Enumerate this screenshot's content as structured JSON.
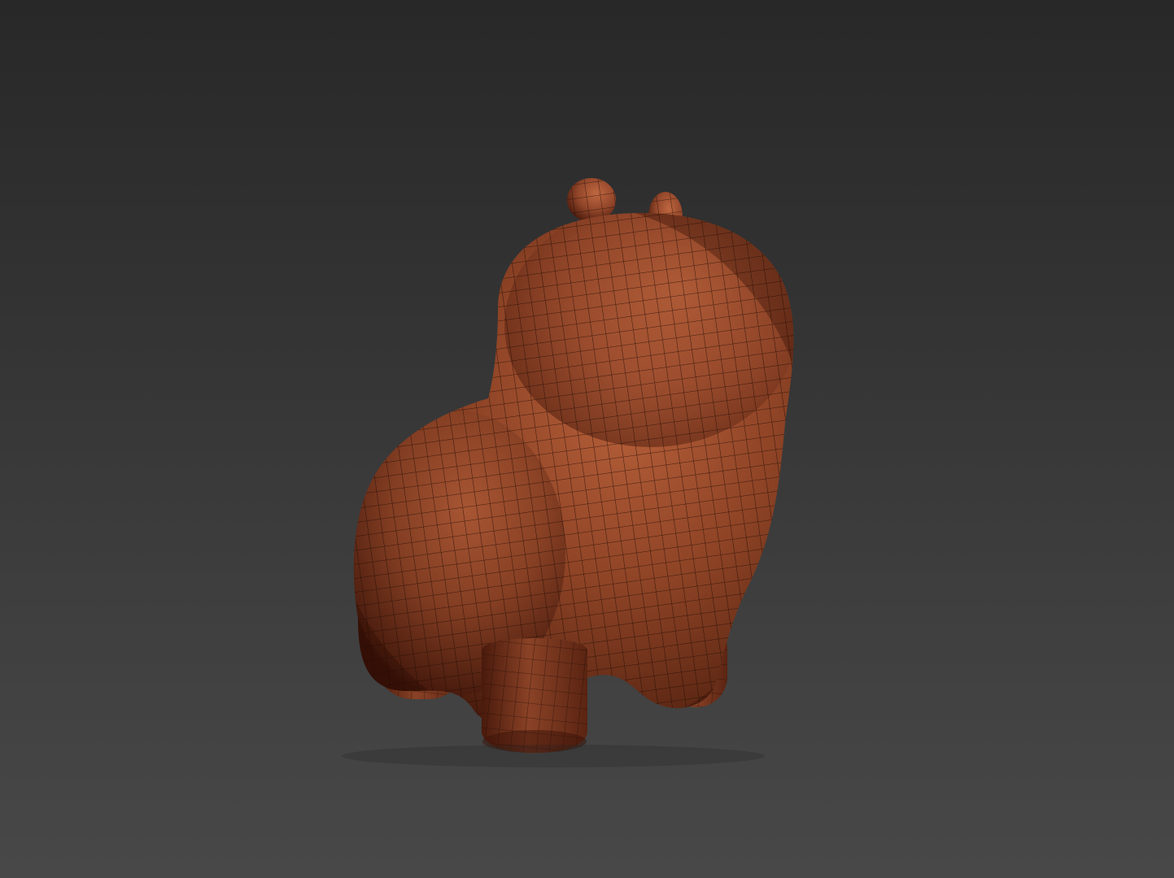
{
  "viewport": {
    "background_top": "#282828",
    "background_bottom": "#484848"
  },
  "model": {
    "shading_mode": "smooth-with-wireframe",
    "surface_color": "#9a4a2a",
    "shadow_color": "#3a1208",
    "highlight_color": "#c06a44",
    "wire_color": "#1c0a04"
  }
}
